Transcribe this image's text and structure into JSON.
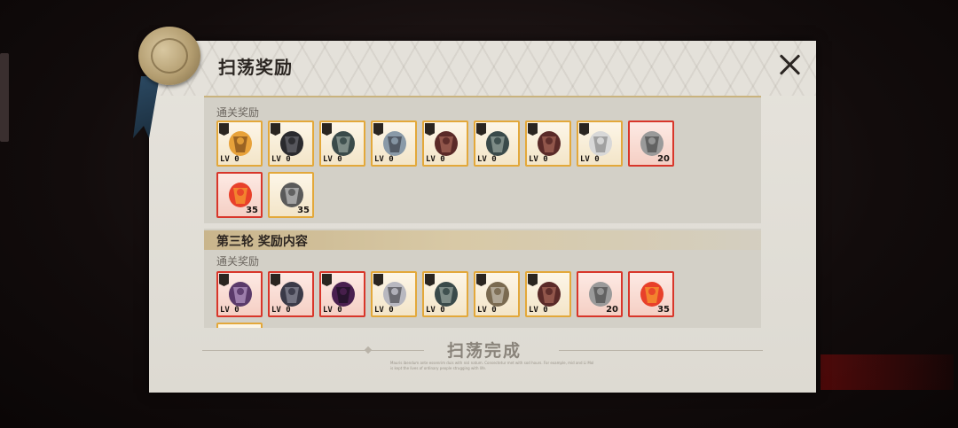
{
  "dialog": {
    "title": "扫荡奖励",
    "close_icon": "close-icon"
  },
  "section_1": {
    "label": "通关奖励",
    "items": [
      {
        "icon": "fiery-armor-icon",
        "frame": "gold",
        "lv": "LV 0"
      },
      {
        "icon": "dark-coat-icon",
        "frame": "gold",
        "lv": "LV 0"
      },
      {
        "icon": "scroll-icon",
        "frame": "gold",
        "lv": "LV 0"
      },
      {
        "icon": "sword-hilt-icon",
        "frame": "gold",
        "lv": "LV 0"
      },
      {
        "icon": "coffin-icon",
        "frame": "gold",
        "lv": "LV 0"
      },
      {
        "icon": "scroll-icon",
        "frame": "gold",
        "lv": "LV 0"
      },
      {
        "icon": "coffin-icon",
        "frame": "gold",
        "lv": "LV 0"
      },
      {
        "icon": "white-robe-icon",
        "frame": "gold",
        "lv": "LV 0"
      },
      {
        "icon": "metal-ingot-icon",
        "frame": "red",
        "qty": "20"
      },
      {
        "icon": "fire-essence-icon",
        "frame": "red",
        "qty": "35"
      },
      {
        "icon": "silver-gem-icon",
        "frame": "gold",
        "qty": "35"
      }
    ]
  },
  "section_2": {
    "title": "第三轮 奖励内容",
    "label": "通关奖励",
    "items": [
      {
        "icon": "purple-armor-icon",
        "frame": "red",
        "lv": "LV 0"
      },
      {
        "icon": "dark-armor-icon",
        "frame": "red",
        "lv": "LV 0"
      },
      {
        "icon": "purple-cloak-icon",
        "frame": "red",
        "lv": "LV 0"
      },
      {
        "icon": "mace-icon",
        "frame": "gold",
        "lv": "LV 0"
      },
      {
        "icon": "scroll-icon",
        "frame": "gold",
        "lv": "LV 0"
      },
      {
        "icon": "hammer-icon",
        "frame": "gold",
        "lv": "LV 0"
      },
      {
        "icon": "coffin-icon",
        "frame": "gold",
        "lv": "LV 0"
      },
      {
        "icon": "metal-ingot-icon",
        "frame": "red",
        "qty": "20"
      },
      {
        "icon": "fire-essence-icon",
        "frame": "red",
        "qty": "35"
      }
    ]
  },
  "footer": {
    "status": "扫荡完成",
    "note": "Mauris ibendum ante essenrim duis with nisl natum. Consectetur met with sod hours. For example, mid and Li Mol is kept the lives of ordinary people strugging with life."
  },
  "colors": {
    "gold_frame": "#e3a83a",
    "red_frame": "#d8362a",
    "panel": "#e6e3dc"
  }
}
